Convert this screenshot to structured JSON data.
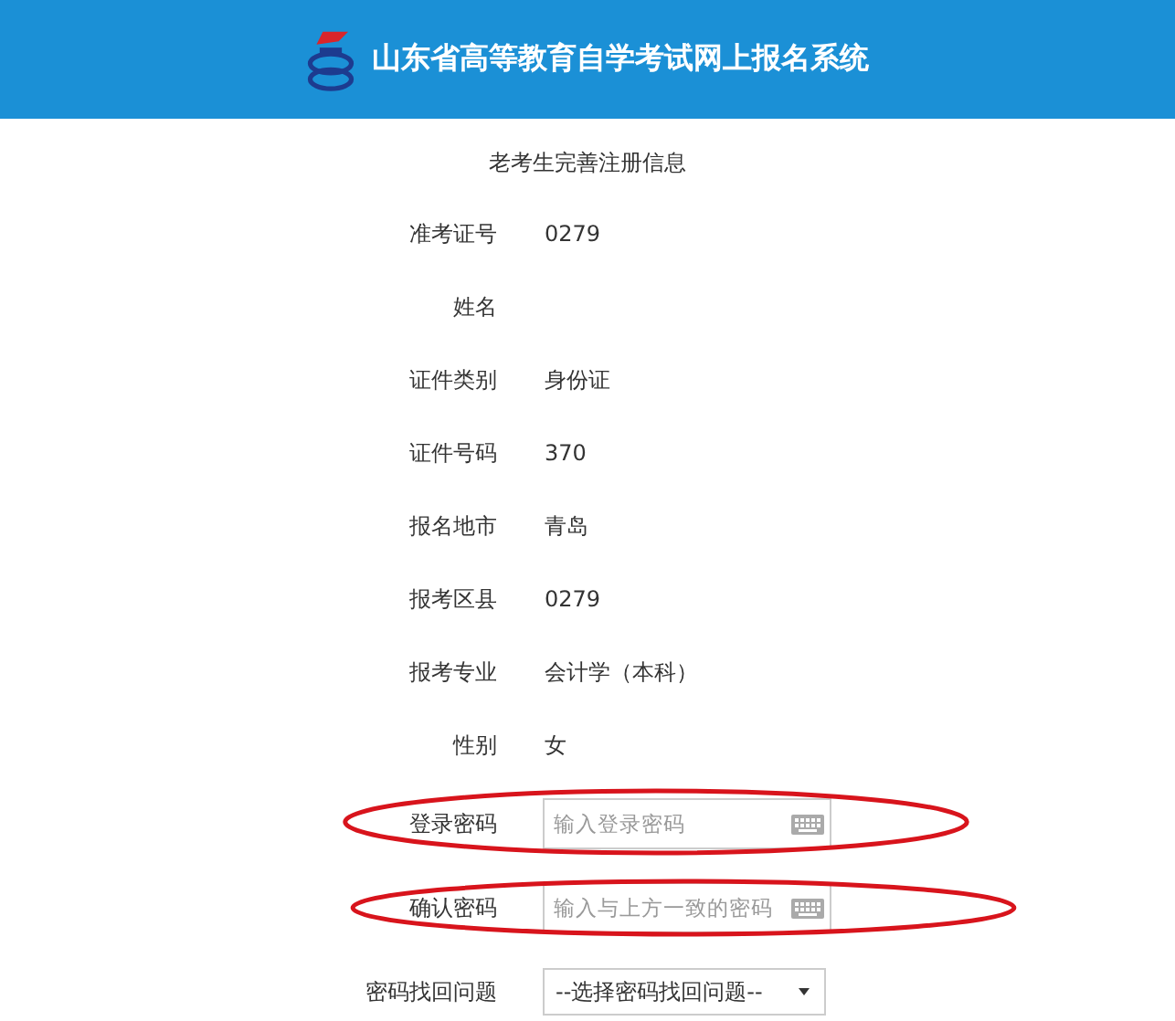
{
  "header": {
    "title": "山东省高等教育自学考试网上报名系统"
  },
  "form": {
    "title": "老考生完善注册信息",
    "rows": [
      {
        "kind": "text",
        "label": "准考证号",
        "value": "0279",
        "highlighted": false
      },
      {
        "kind": "text",
        "label": "姓名",
        "highlighted": false
      },
      {
        "kind": "text",
        "label": "证件类别",
        "value": "身份证",
        "highlighted": false
      },
      {
        "kind": "text",
        "label": "证件号码",
        "value": "370",
        "highlighted": false
      },
      {
        "kind": "text",
        "label": "报名地市",
        "value": "青岛",
        "highlighted": false
      },
      {
        "kind": "text",
        "label": "报考区县",
        "value": "0279",
        "highlighted": false
      },
      {
        "kind": "text",
        "label": "报考专业",
        "value": "会计学（本科）",
        "highlighted": false
      },
      {
        "kind": "text",
        "label": "性别",
        "value": "女",
        "highlighted": false
      },
      {
        "kind": "input",
        "label": "登录密码",
        "placeholder": "输入登录密码",
        "highlighted": true
      },
      {
        "kind": "input",
        "label": "确认密码",
        "placeholder": "输入与上方一致的密码",
        "highlighted": true
      },
      {
        "kind": "select",
        "label": "密码找回问题",
        "value": "--选择密码找回问题--",
        "highlighted": false
      }
    ]
  }
}
